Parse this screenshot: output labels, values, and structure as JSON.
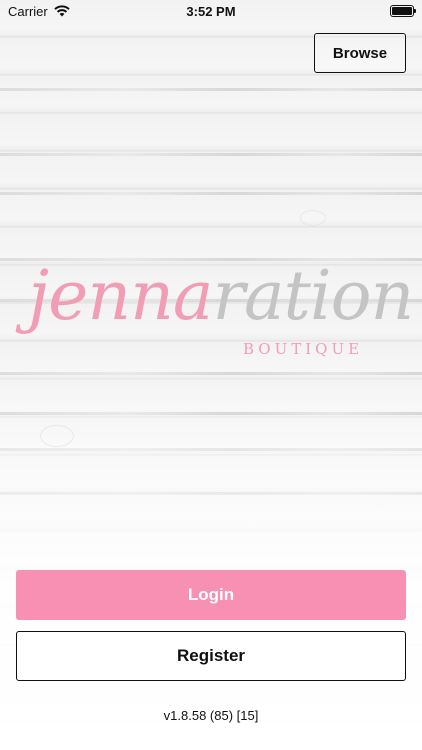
{
  "status_bar": {
    "carrier": "Carrier",
    "time": "3:52 PM",
    "icons": [
      "wifi-icon",
      "battery-icon"
    ]
  },
  "header": {
    "browse_label": "Browse"
  },
  "logo": {
    "script_pink": "jenna",
    "script_grey": "ration",
    "subtitle": "BOUTIQUE"
  },
  "actions": {
    "login_label": "Login",
    "register_label": "Register"
  },
  "footer": {
    "version": "v1.8.58 (85) [15]"
  },
  "colors": {
    "accent_pink": "#f790b3",
    "logo_pink": "#f29db6",
    "logo_grey": "#c4c4c4"
  }
}
